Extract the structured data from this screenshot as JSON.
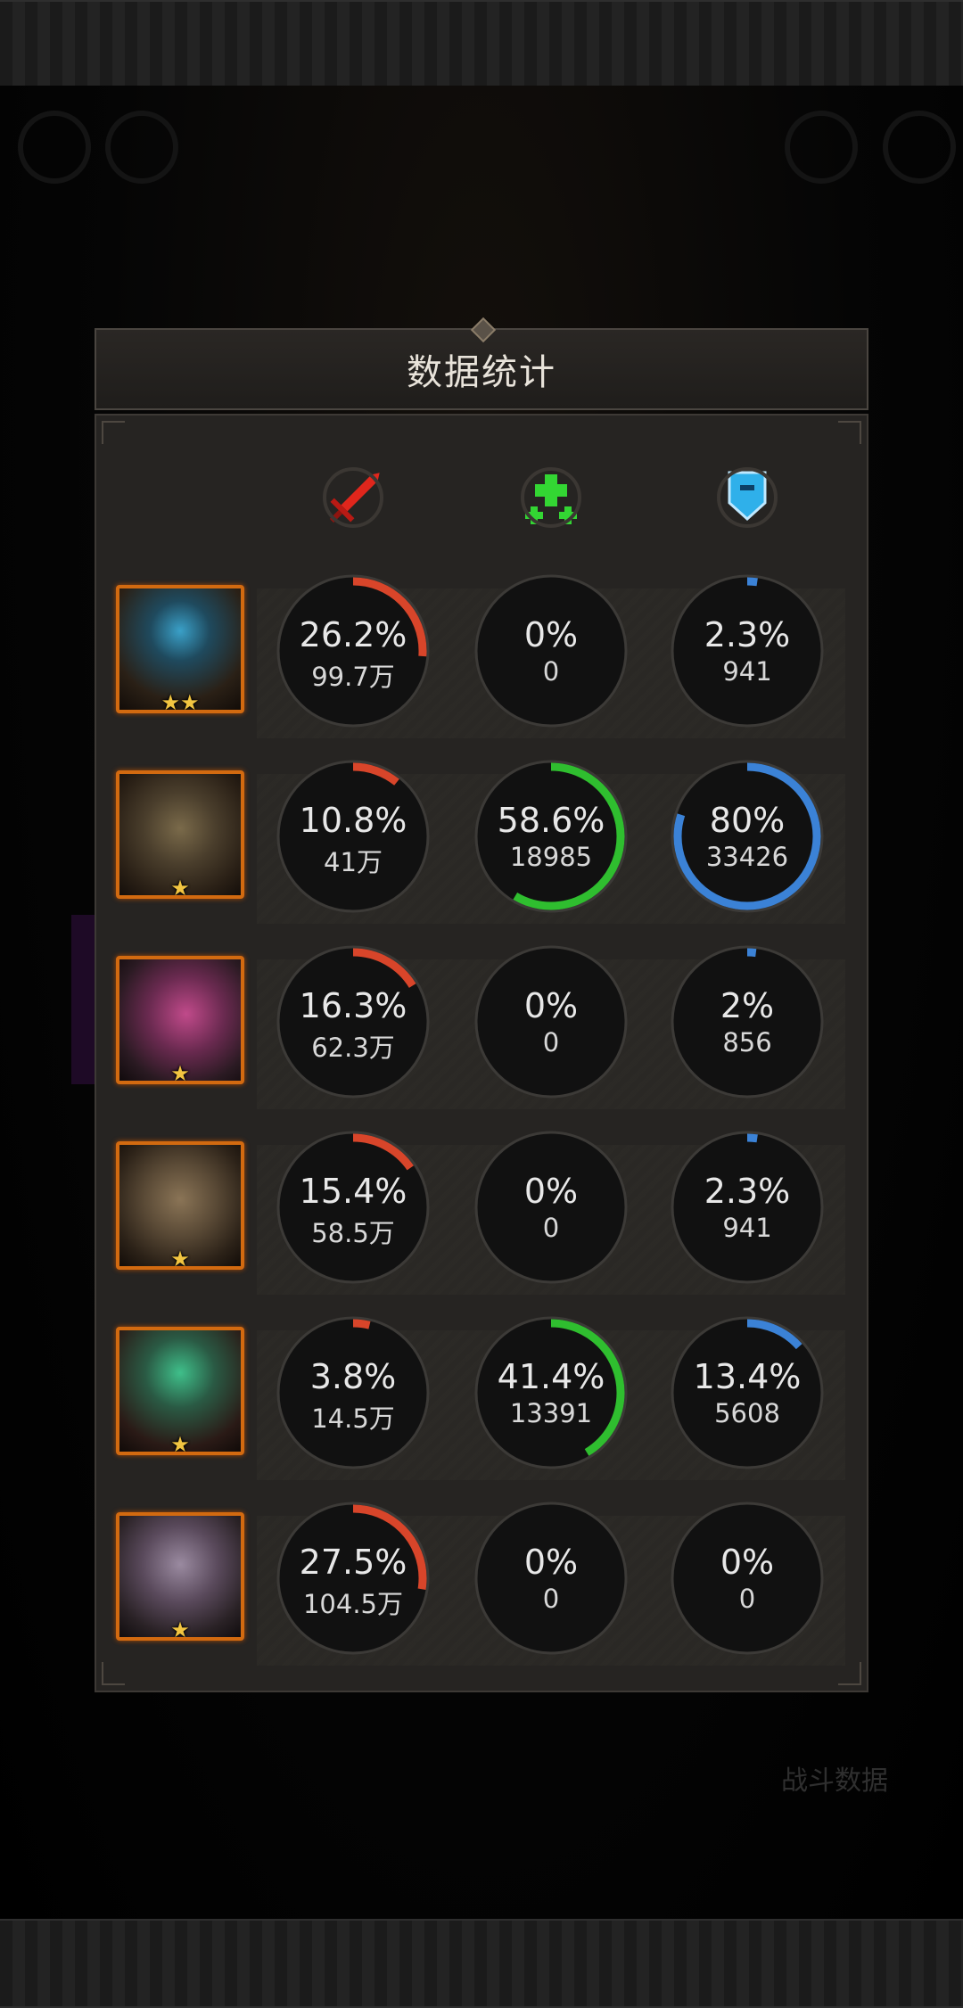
{
  "panel": {
    "title": "数据统计"
  },
  "columns": [
    {
      "icon": "damage-sword-icon",
      "color": "#d8382a"
    },
    {
      "icon": "healing-cross-icon",
      "color": "#27c42c"
    },
    {
      "icon": "defense-shield-icon",
      "color": "#3aa5e6"
    }
  ],
  "colors": {
    "damage": "#d8452a",
    "heal": "#2fbe2f",
    "tank": "#3b82d6",
    "ring_track": "#111111",
    "ring_border": "#3c3a37"
  },
  "heroes": [
    {
      "stars": "★★",
      "damage": {
        "pct": "26.2%",
        "value": "99.7万",
        "ratio": 0.262
      },
      "heal": {
        "pct": "0%",
        "value": "0",
        "ratio": 0
      },
      "tank": {
        "pct": "2.3%",
        "value": "941",
        "ratio": 0.023
      }
    },
    {
      "stars": "★",
      "damage": {
        "pct": "10.8%",
        "value": "41万",
        "ratio": 0.108
      },
      "heal": {
        "pct": "58.6%",
        "value": "18985",
        "ratio": 0.586
      },
      "tank": {
        "pct": "80%",
        "value": "33426",
        "ratio": 0.8
      }
    },
    {
      "stars": "★",
      "damage": {
        "pct": "16.3%",
        "value": "62.3万",
        "ratio": 0.163
      },
      "heal": {
        "pct": "0%",
        "value": "0",
        "ratio": 0
      },
      "tank": {
        "pct": "2%",
        "value": "856",
        "ratio": 0.02
      }
    },
    {
      "stars": "★",
      "damage": {
        "pct": "15.4%",
        "value": "58.5万",
        "ratio": 0.154
      },
      "heal": {
        "pct": "0%",
        "value": "0",
        "ratio": 0
      },
      "tank": {
        "pct": "2.3%",
        "value": "941",
        "ratio": 0.023
      }
    },
    {
      "stars": "★",
      "damage": {
        "pct": "3.8%",
        "value": "14.5万",
        "ratio": 0.038
      },
      "heal": {
        "pct": "41.4%",
        "value": "13391",
        "ratio": 0.414
      },
      "tank": {
        "pct": "13.4%",
        "value": "5608",
        "ratio": 0.134
      }
    },
    {
      "stars": "★",
      "damage": {
        "pct": "27.5%",
        "value": "104.5万",
        "ratio": 0.275
      },
      "heal": {
        "pct": "0%",
        "value": "0",
        "ratio": 0
      },
      "tank": {
        "pct": "0%",
        "value": "0",
        "ratio": 0
      }
    }
  ],
  "background": {
    "battle_data_label": "战斗数据"
  }
}
